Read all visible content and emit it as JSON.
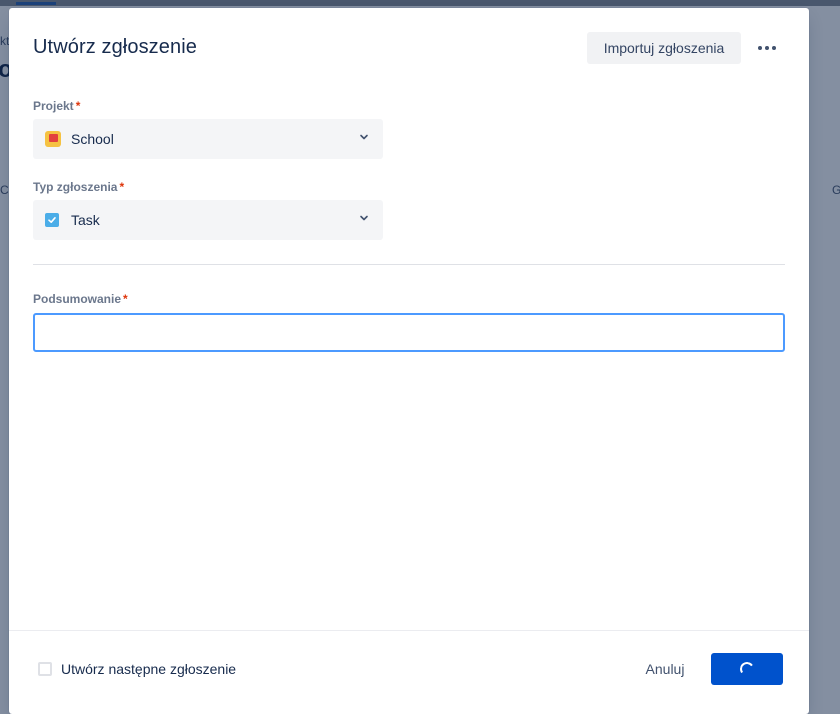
{
  "background": {
    "fragments": [
      "kt",
      "ol",
      "CK",
      "G"
    ]
  },
  "modal": {
    "title": "Utwórz zgłoszenie",
    "import_label": "Importuj zgłoszenia",
    "more_icon": "more-horizontal-icon"
  },
  "fields": {
    "project": {
      "label": "Projekt",
      "required_mark": "*",
      "value": "School",
      "icon": "project-flag-icon"
    },
    "issue_type": {
      "label": "Typ zgłoszenia",
      "required_mark": "*",
      "value": "Task",
      "icon": "task-checkbox-icon"
    },
    "summary": {
      "label": "Podsumowanie",
      "required_mark": "*",
      "value": "",
      "placeholder": ""
    }
  },
  "footer": {
    "create_another_label": "Utwórz następne zgłoszenie",
    "create_another_checked": false,
    "cancel_label": "Anuluj",
    "submit_state": "loading"
  },
  "colors": {
    "primary": "#0052cc",
    "focus": "#4c9aff",
    "required": "#de350b"
  }
}
